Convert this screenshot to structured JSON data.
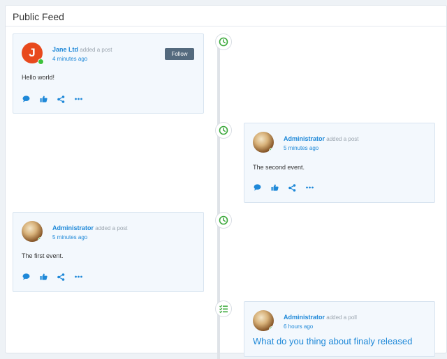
{
  "panel": {
    "title": "Public Feed"
  },
  "feed": [
    {
      "avatar_letter": "J",
      "author": "Jane Ltd",
      "action": "added a post",
      "time": "4 minutes ago",
      "text": "Hello world!",
      "follow_label": "Follow",
      "marker_icon": "clock-icon"
    },
    {
      "author": "Administrator",
      "action": "added a post",
      "time": "5 minutes ago",
      "text": "The second event.",
      "marker_icon": "clock-icon"
    },
    {
      "author": "Administrator",
      "action": "added a post",
      "time": "5 minutes ago",
      "text": "The first event.",
      "marker_icon": "clock-icon"
    },
    {
      "author": "Administrator",
      "action": "added a poll",
      "time": "6 hours ago",
      "text": "What do you thing about finaly released",
      "marker_icon": "checklist-icon"
    }
  ],
  "action_icons": [
    "comment-icon",
    "like-icon",
    "share-icon",
    "more-icon"
  ],
  "colors": {
    "accent": "#1e88d8",
    "marker_green": "#3aa83a",
    "online": "#3cc13b",
    "follow_button": "#546a7e",
    "avatar_jane": "#e8491d"
  }
}
